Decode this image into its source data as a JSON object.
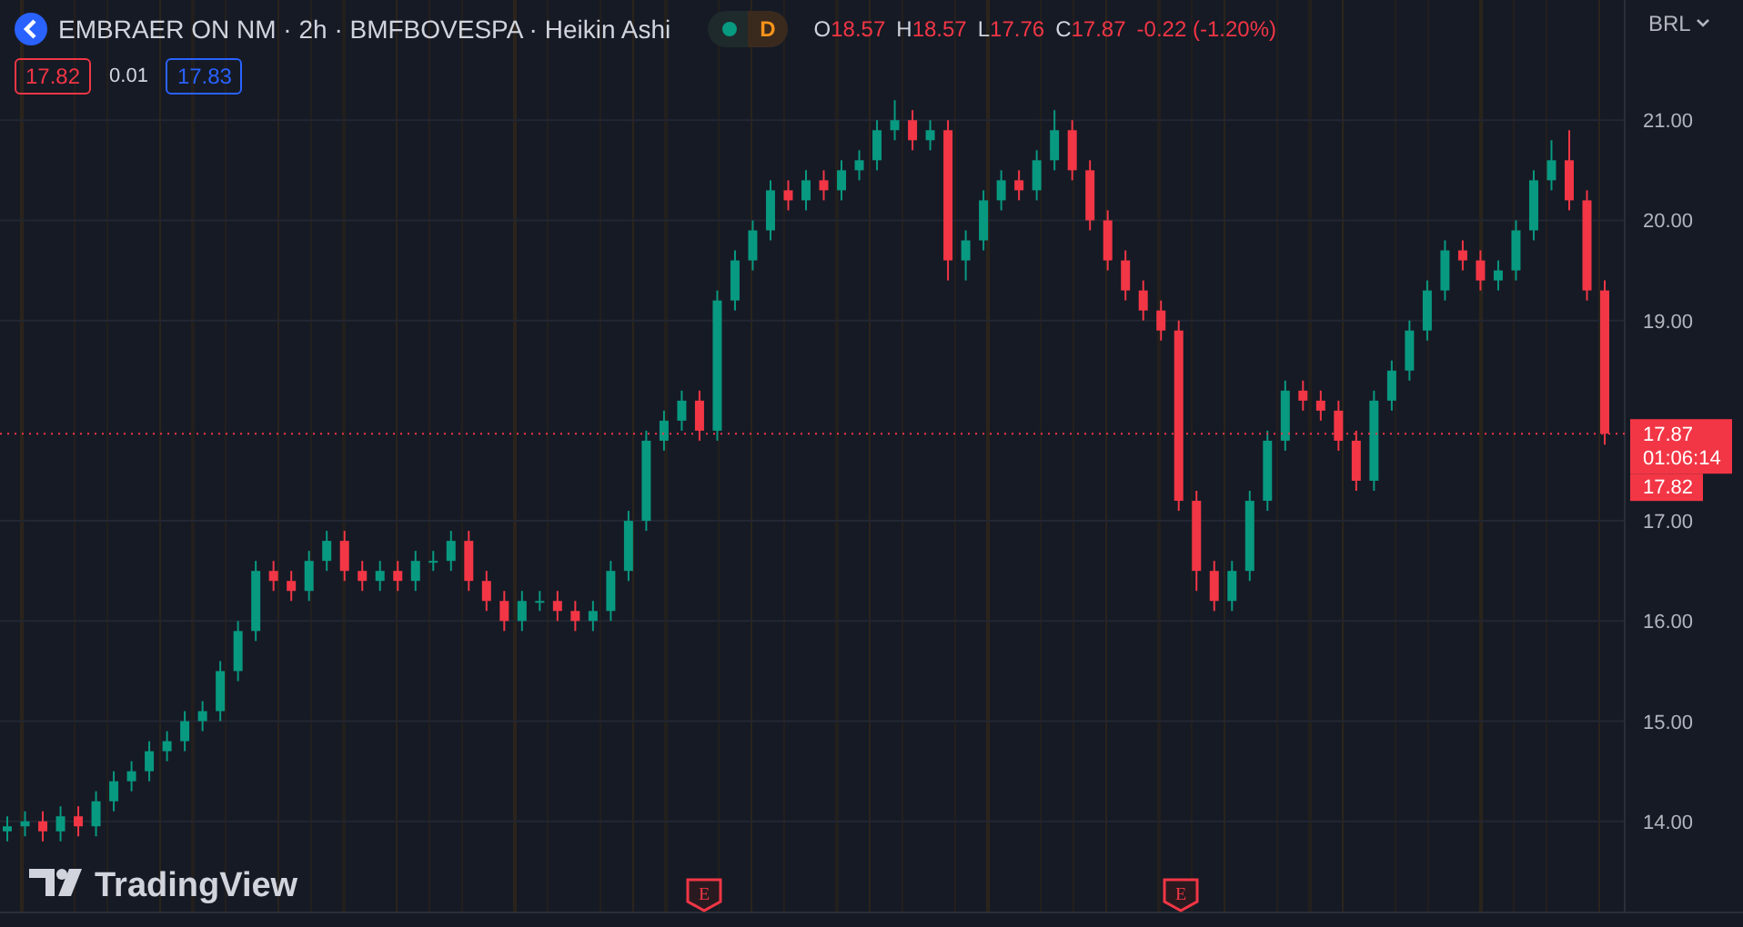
{
  "header": {
    "title": "EMBRAER ON NM · 2h · BMFBOVESPA · Heikin Ashi",
    "market_open": true,
    "status_letter": "D",
    "ohlc": [
      {
        "label": "O",
        "value": "18.57"
      },
      {
        "label": "H",
        "value": "18.57"
      },
      {
        "label": "L",
        "value": "17.76"
      },
      {
        "label": "C",
        "value": "17.87"
      }
    ],
    "change": "-0.22 (-1.20%)",
    "bid": "17.82",
    "spread": "0.01",
    "ask": "17.83"
  },
  "currency": "BRL",
  "chart": {
    "chart_data": {
      "type": "candlestick",
      "grid": true,
      "ylim": [
        13.09,
        22.2
      ],
      "yticks": [
        {
          "value": 14,
          "label": "14.00"
        },
        {
          "value": 15,
          "label": "15.00"
        },
        {
          "value": 16,
          "label": "16.00"
        },
        {
          "value": 17,
          "label": "17.00"
        },
        {
          "value": 19,
          "label": "19.00"
        },
        {
          "value": 20,
          "label": "20.00"
        },
        {
          "value": 21,
          "label": "21.00"
        }
      ],
      "ohlc": [
        [
          13.9,
          14.05,
          13.8,
          13.95
        ],
        [
          13.95,
          14.1,
          13.85,
          14.0
        ],
        [
          14.0,
          14.1,
          13.8,
          13.9
        ],
        [
          13.9,
          14.15,
          13.8,
          14.05
        ],
        [
          14.05,
          14.15,
          13.85,
          13.95
        ],
        [
          13.95,
          14.3,
          13.85,
          14.2
        ],
        [
          14.2,
          14.5,
          14.1,
          14.4
        ],
        [
          14.4,
          14.6,
          14.3,
          14.5
        ],
        [
          14.5,
          14.8,
          14.4,
          14.7
        ],
        [
          14.7,
          14.9,
          14.6,
          14.8
        ],
        [
          14.8,
          15.1,
          14.7,
          15.0
        ],
        [
          15.0,
          15.2,
          14.9,
          15.1
        ],
        [
          15.1,
          15.6,
          15.0,
          15.5
        ],
        [
          15.5,
          16.0,
          15.4,
          15.9
        ],
        [
          15.9,
          16.6,
          15.8,
          16.5
        ],
        [
          16.5,
          16.6,
          16.3,
          16.4
        ],
        [
          16.4,
          16.5,
          16.2,
          16.3
        ],
        [
          16.3,
          16.7,
          16.2,
          16.6
        ],
        [
          16.6,
          16.9,
          16.5,
          16.8
        ],
        [
          16.8,
          16.9,
          16.4,
          16.5
        ],
        [
          16.5,
          16.6,
          16.3,
          16.4
        ],
        [
          16.4,
          16.6,
          16.3,
          16.5
        ],
        [
          16.5,
          16.6,
          16.3,
          16.4
        ],
        [
          16.4,
          16.7,
          16.3,
          16.6
        ],
        [
          16.6,
          16.7,
          16.5,
          16.6
        ],
        [
          16.6,
          16.9,
          16.5,
          16.8
        ],
        [
          16.8,
          16.9,
          16.3,
          16.4
        ],
        [
          16.4,
          16.5,
          16.1,
          16.2
        ],
        [
          16.2,
          16.3,
          15.9,
          16.0
        ],
        [
          16.0,
          16.3,
          15.9,
          16.2
        ],
        [
          16.2,
          16.3,
          16.1,
          16.2
        ],
        [
          16.2,
          16.3,
          16.0,
          16.1
        ],
        [
          16.1,
          16.2,
          15.9,
          16.0
        ],
        [
          16.0,
          16.2,
          15.9,
          16.1
        ],
        [
          16.1,
          16.6,
          16.0,
          16.5
        ],
        [
          16.5,
          17.1,
          16.4,
          17.0
        ],
        [
          17.0,
          17.9,
          16.9,
          17.8
        ],
        [
          17.8,
          18.1,
          17.7,
          18.0
        ],
        [
          18.0,
          18.3,
          17.9,
          18.2
        ],
        [
          18.2,
          18.3,
          17.8,
          17.9
        ],
        [
          17.9,
          19.3,
          17.8,
          19.2
        ],
        [
          19.2,
          19.7,
          19.1,
          19.6
        ],
        [
          19.6,
          20.0,
          19.5,
          19.9
        ],
        [
          19.9,
          20.4,
          19.8,
          20.3
        ],
        [
          20.3,
          20.4,
          20.1,
          20.2
        ],
        [
          20.2,
          20.5,
          20.1,
          20.4
        ],
        [
          20.4,
          20.5,
          20.2,
          20.3
        ],
        [
          20.3,
          20.6,
          20.2,
          20.5
        ],
        [
          20.5,
          20.7,
          20.4,
          20.6
        ],
        [
          20.6,
          21.0,
          20.5,
          20.9
        ],
        [
          20.9,
          21.2,
          20.8,
          21.0
        ],
        [
          21.0,
          21.1,
          20.7,
          20.8
        ],
        [
          20.8,
          21.0,
          20.7,
          20.9
        ],
        [
          20.9,
          21.0,
          19.4,
          19.6
        ],
        [
          19.6,
          19.9,
          19.4,
          19.8
        ],
        [
          19.8,
          20.3,
          19.7,
          20.2
        ],
        [
          20.2,
          20.5,
          20.1,
          20.4
        ],
        [
          20.4,
          20.5,
          20.2,
          20.3
        ],
        [
          20.3,
          20.7,
          20.2,
          20.6
        ],
        [
          20.6,
          21.1,
          20.5,
          20.9
        ],
        [
          20.9,
          21.0,
          20.4,
          20.5
        ],
        [
          20.5,
          20.6,
          19.9,
          20.0
        ],
        [
          20.0,
          20.1,
          19.5,
          19.6
        ],
        [
          19.6,
          19.7,
          19.2,
          19.3
        ],
        [
          19.3,
          19.4,
          19.0,
          19.1
        ],
        [
          19.1,
          19.2,
          18.8,
          18.9
        ],
        [
          18.9,
          19.0,
          17.1,
          17.2
        ],
        [
          17.2,
          17.3,
          16.3,
          16.5
        ],
        [
          16.5,
          16.6,
          16.1,
          16.2
        ],
        [
          16.2,
          16.6,
          16.1,
          16.5
        ],
        [
          16.5,
          17.3,
          16.4,
          17.2
        ],
        [
          17.2,
          17.9,
          17.1,
          17.8
        ],
        [
          17.8,
          18.4,
          17.7,
          18.3
        ],
        [
          18.3,
          18.4,
          18.1,
          18.2
        ],
        [
          18.2,
          18.3,
          18.0,
          18.1
        ],
        [
          18.1,
          18.2,
          17.7,
          17.8
        ],
        [
          17.8,
          17.9,
          17.3,
          17.4
        ],
        [
          17.4,
          18.3,
          17.3,
          18.2
        ],
        [
          18.2,
          18.6,
          18.1,
          18.5
        ],
        [
          18.5,
          19.0,
          18.4,
          18.9
        ],
        [
          18.9,
          19.4,
          18.8,
          19.3
        ],
        [
          19.3,
          19.8,
          19.2,
          19.7
        ],
        [
          19.7,
          19.8,
          19.5,
          19.6
        ],
        [
          19.6,
          19.7,
          19.3,
          19.4
        ],
        [
          19.4,
          19.6,
          19.3,
          19.5
        ],
        [
          19.5,
          20.0,
          19.4,
          19.9
        ],
        [
          19.9,
          20.5,
          19.8,
          20.4
        ],
        [
          20.4,
          20.8,
          20.3,
          20.6
        ],
        [
          20.6,
          20.9,
          20.1,
          20.2
        ],
        [
          20.2,
          20.3,
          19.2,
          19.3
        ],
        [
          19.3,
          19.4,
          17.76,
          17.87
        ]
      ]
    }
  },
  "price_tag": {
    "price": "17.87",
    "countdown": "01:06:14",
    "bid": "17.82"
  },
  "markers": [
    {
      "label": "E"
    },
    {
      "label": "E"
    }
  ],
  "branding": "TradingView"
}
